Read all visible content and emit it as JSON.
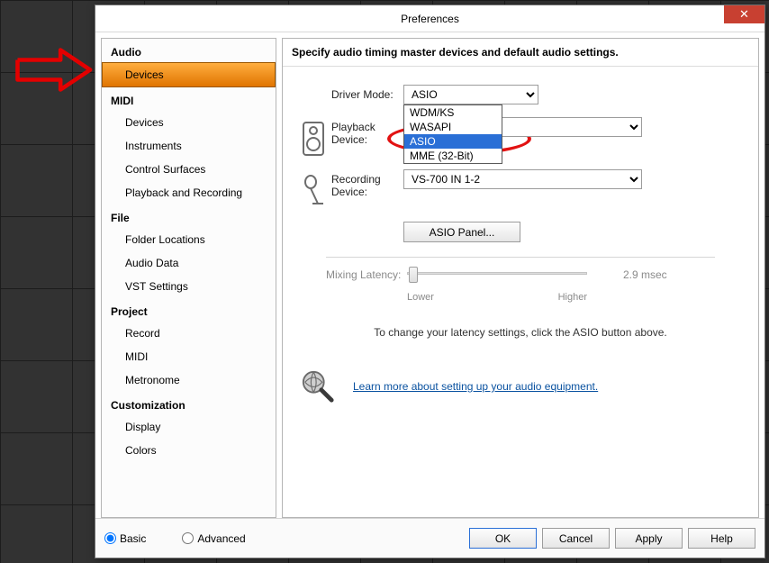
{
  "window": {
    "title": "Preferences"
  },
  "header": "Specify audio timing master devices and default audio settings.",
  "nav": {
    "categories": [
      {
        "label": "Audio",
        "items": [
          "Devices"
        ]
      },
      {
        "label": "MIDI",
        "items": [
          "Devices",
          "Instruments",
          "Control Surfaces",
          "Playback and Recording"
        ]
      },
      {
        "label": "File",
        "items": [
          "Folder Locations",
          "Audio Data",
          "VST Settings"
        ]
      },
      {
        "label": "Project",
        "items": [
          "Record",
          "MIDI",
          "Metronome"
        ]
      },
      {
        "label": "Customization",
        "items": [
          "Display",
          "Colors"
        ]
      }
    ],
    "active": "Devices"
  },
  "form": {
    "driver_mode": {
      "label": "Driver Mode:",
      "value": "ASIO",
      "options": [
        "WDM/KS",
        "WASAPI",
        "ASIO",
        "MME (32-Bit)"
      ]
    },
    "playback": {
      "label": "Playback Device:"
    },
    "recording": {
      "label": "Recording Device:",
      "value": "VS-700 IN 1-2"
    },
    "asio_panel": "ASIO Panel..."
  },
  "slider": {
    "label": "Mixing Latency:",
    "lower": "Lower",
    "higher": "Higher",
    "value": "2.9 msec"
  },
  "hint": "To change your latency settings, click the ASIO button above.",
  "learn_more": "Learn more about setting up your audio equipment.",
  "footer": {
    "basic": "Basic",
    "advanced": "Advanced",
    "ok": "OK",
    "cancel": "Cancel",
    "apply": "Apply",
    "help": "Help"
  }
}
